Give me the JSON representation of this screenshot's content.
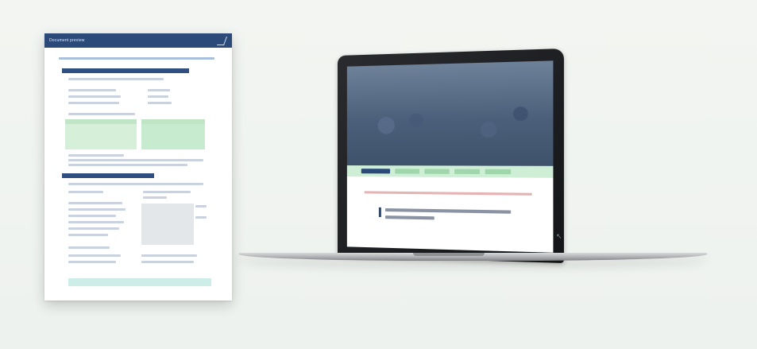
{
  "document": {
    "title": "Document preview",
    "accent_color": "#2b4a7a",
    "highlight_color": "#d5efd9"
  },
  "laptop": {
    "hero_title": "",
    "accent_color": "#2b4a7a",
    "nav_color": "#cfeed6"
  },
  "icons": {
    "doc_logo": "chevron-icon",
    "cursor": "cursor-icon"
  }
}
